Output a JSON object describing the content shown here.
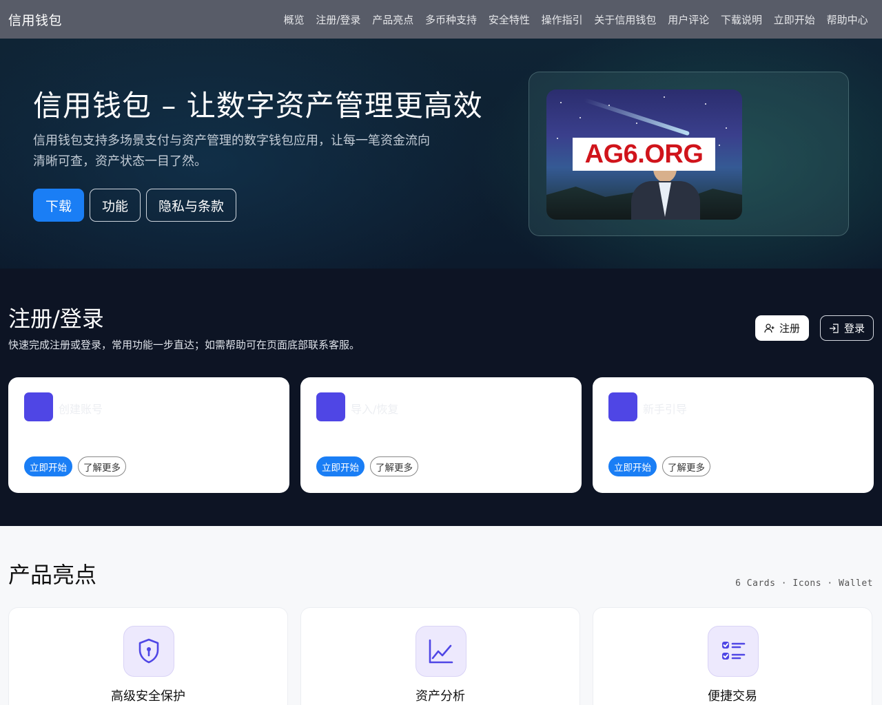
{
  "nav": {
    "brand": "信用钱包",
    "links": [
      "概览",
      "注册/登录",
      "产品亮点",
      "多币种支持",
      "安全特性",
      "操作指引",
      "关于信用钱包",
      "用户评论",
      "下载说明",
      "立即开始",
      "帮助中心"
    ]
  },
  "hero": {
    "title": "信用钱包 – 让数字资产管理更高效",
    "description": "信用钱包支持多场景支付与资产管理的数字钱包应用，让每一笔资金流向清晰可查，资产状态一目了然。",
    "buttons": {
      "download": "下载",
      "features": "功能",
      "privacy": "隐私与条款"
    },
    "image_sign": "AG6.ORG",
    "colors": {
      "primary": "#1a7ef5"
    }
  },
  "register": {
    "title": "注册/登录",
    "subtitle": "快速完成注册或登录，常用功能一步直达；如需帮助可在页面底部联系客服。",
    "register_label": "注册",
    "login_label": "登录",
    "cards": [
      {
        "title": "创建账号",
        "start": "立即开始",
        "more": "了解更多"
      },
      {
        "title": "导入/恢复",
        "start": "立即开始",
        "more": "了解更多"
      },
      {
        "title": "新手引导",
        "start": "立即开始",
        "more": "了解更多"
      }
    ],
    "icons": {
      "register": "user-plus-icon",
      "login": "sign-in-icon"
    },
    "colors": {
      "card_square": "#4f46e5"
    }
  },
  "highlights": {
    "title": "产品亮点",
    "meta": "6 Cards · Icons · Wallet",
    "cards": [
      {
        "label": "高级安全保护",
        "icon": "shield-lock-icon"
      },
      {
        "label": "资产分析",
        "icon": "line-chart-icon"
      },
      {
        "label": "便捷交易",
        "icon": "checklist-icon"
      }
    ],
    "colors": {
      "icon_accent": "#4f46e5"
    }
  }
}
